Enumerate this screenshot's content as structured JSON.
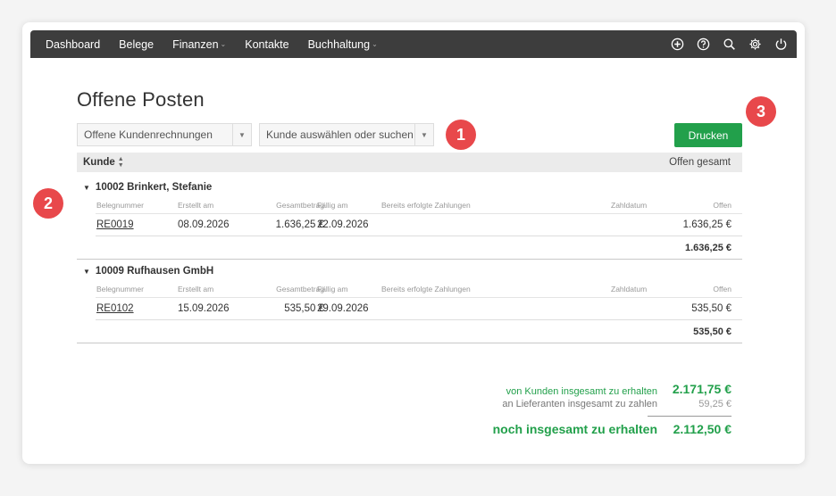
{
  "nav": {
    "items": [
      {
        "label": "Dashboard"
      },
      {
        "label": "Belege"
      },
      {
        "label": "Finanzen"
      },
      {
        "label": "Kontakte"
      },
      {
        "label": "Buchhaltung"
      }
    ],
    "icons": [
      "plus-circle-icon",
      "help-icon",
      "search-icon",
      "settings-icon",
      "power-icon"
    ]
  },
  "page": {
    "title": "Offene Posten"
  },
  "filters": {
    "type_select": "Offene Kundenrechnungen",
    "customer_select": "Kunde auswählen oder suchen"
  },
  "badges": [
    "1",
    "2",
    "3"
  ],
  "print_button": "Drucken",
  "table": {
    "col_customer": "Kunde",
    "col_open_total": "Offen gesamt",
    "columns": [
      "Belegnummer",
      "Erstellt am",
      "Gesamtbetrag",
      "Fällig am",
      "Bereits erfolgte Zahlungen",
      "Zahldatum",
      "Offen"
    ],
    "groups": [
      {
        "name": "10002 Brinkert, Stefanie",
        "rows": [
          {
            "beleg": "RE0019",
            "erstellt": "08.09.2026",
            "gesamt": "1.636,25 €",
            "faellig": "22.09.2026",
            "bereits": "",
            "zahldatum": "",
            "offen": "1.636,25 €"
          }
        ],
        "sum": "1.636,25 €"
      },
      {
        "name": "10009 Rufhausen GmbH",
        "rows": [
          {
            "beleg": "RE0102",
            "erstellt": "15.09.2026",
            "gesamt": "535,50 €",
            "faellig": "29.09.2026",
            "bereits": "",
            "zahldatum": "",
            "offen": "535,50 €"
          }
        ],
        "sum": "535,50 €"
      }
    ]
  },
  "totals": {
    "from_customers_label": "von Kunden insgesamt zu erhalten",
    "from_customers_value": "2.171,75 €",
    "to_suppliers_label": "an Lieferanten insgesamt zu zahlen",
    "to_suppliers_value": "59,25 €",
    "remaining_label": "noch insgesamt zu erhalten",
    "remaining_value": "2.112,50 €"
  },
  "colors": {
    "accent": "#22a04b",
    "badge": "#e8484b",
    "nav": "#3d3d3d"
  }
}
